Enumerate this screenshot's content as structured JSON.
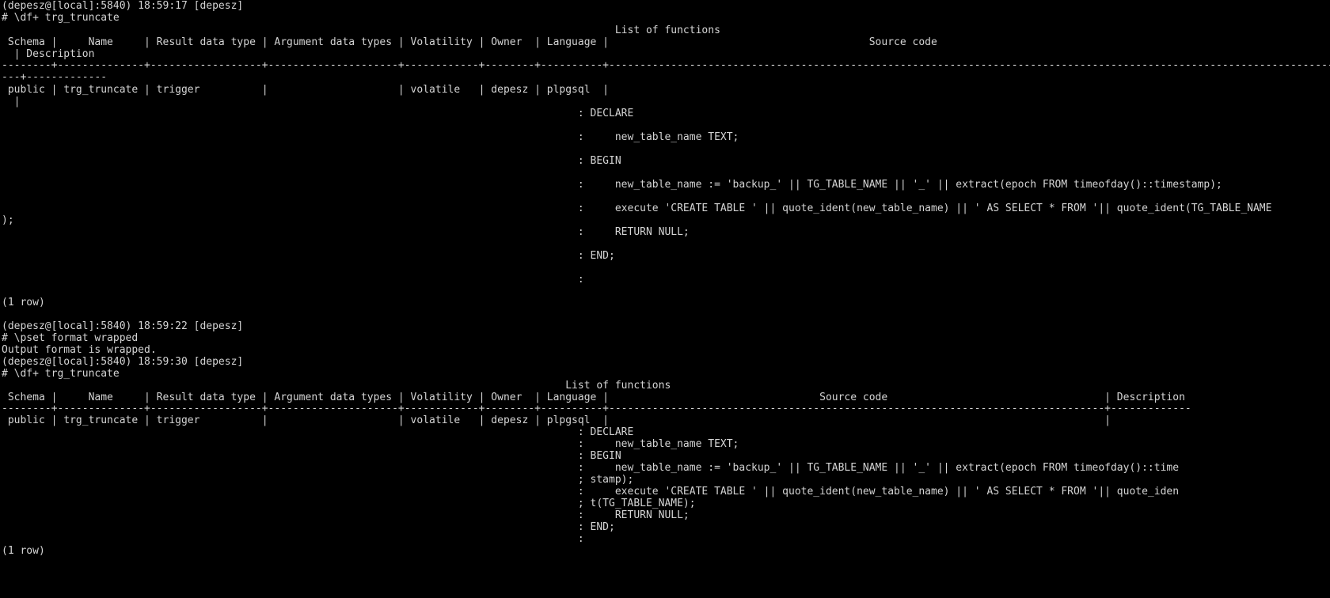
{
  "terminal": {
    "colors": {
      "background": "#000000",
      "foreground": "#d4d4d4"
    },
    "first_listing": [
      "(depesz@[local]:5840) 18:59:17 [depesz]",
      "# \\df+ trg_truncate",
      "                                                                                                   List of functions",
      " Schema |     Name     | Result data type | Argument data types | Volatility | Owner  | Language |                                          Source code",
      "  | Description",
      "--------+--------------+------------------+---------------------+------------+--------+----------+--------------------------------------------------------------------------------------------------------------------------------------------------------------------------------------------------",
      "---+-------------",
      " public | trg_truncate | trigger          |                     | volatile   | depesz | plpgsql  |",
      "  |",
      "",
      "                                                                                             : DECLARE",
      "",
      "                                                                                             :     new_table_name TEXT;",
      "",
      "                                                                                             : BEGIN",
      "",
      "                                                                                             :     new_table_name := 'backup_' || TG_TABLE_NAME || '_' || extract(epoch FROM timeofday()::timestamp);",
      "",
      "                                                                                             :     execute 'CREATE TABLE ' || quote_ident(new_table_name) || ' AS SELECT * FROM '|| quote_ident(TG_TABLE_NAME",
      ");",
      "                                                                                             :     RETURN NULL;",
      "",
      "                                                                                             : END;",
      "",
      "                                                                                             :",
      "",
      "(1 row)",
      "",
      "(depesz@[local]:5840) 18:59:22 [depesz]",
      "# \\pset format wrapped",
      "Output format is wrapped."
    ],
    "second_listing": [
      "(depesz@[local]:5840) 18:59:30 [depesz]",
      "# \\df+ trg_truncate",
      "                                                                                           List of functions",
      " Schema |     Name     | Result data type | Argument data types | Volatility | Owner  | Language |                                  Source code                                   | Description",
      "--------+--------------+------------------+---------------------+------------+--------+----------+--------------------------------------------------------------------------------+-------------",
      " public | trg_truncate | trigger          |                     | volatile   | depesz | plpgsql  |                                                                                |",
      "                                                                                             : DECLARE",
      "                                                                                             :     new_table_name TEXT;",
      "                                                                                             : BEGIN",
      "                                                                                             :     new_table_name := 'backup_' || TG_TABLE_NAME || '_' || extract(epoch FROM timeofday()::time",
      "                                                                                             ; stamp);",
      "                                                                                             :     execute 'CREATE TABLE ' || quote_ident(new_table_name) || ' AS SELECT * FROM '|| quote_iden",
      "                                                                                             ; t(TG_TABLE_NAME);",
      "                                                                                             :     RETURN NULL;",
      "                                                                                             : END;",
      "                                                                                             :",
      "(1 row)"
    ]
  }
}
